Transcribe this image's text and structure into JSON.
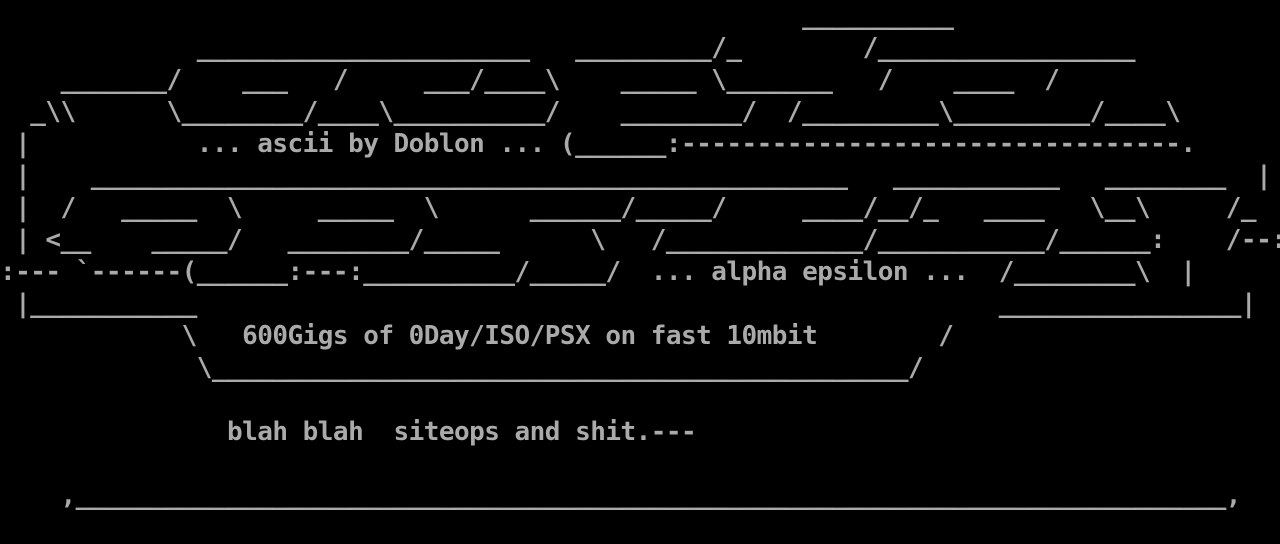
{
  "terminal": {
    "background_color": "#000000",
    "text_color": "#aaaaaa",
    "lines": [
      "                                                     __________",
      "             ______________________   _________/_        /_________________",
      "    _______/    ___   /     ___/____\\    _____ \\_______   /    ____  /",
      "  _\\\\      \\________/____\\__________/    ________/  /_________\\_________/____\\",
      " |           ... ascii by Doblon ... (______:---------------------------------.",
      " |    __________________________________________________   ___________   ________  |",
      " |  /   _____  \\     _____  \\      ______/_____/     ____/__/_   ____   \\__\\     /_  |",
      " | <__    _____/   ________/_____      \\   /_____________/___________/______:    /--:",
      ":--- `------(______:---:__________/_____/  ... alpha epsilon ...  /________\\  |",
      " |___________                                                     ________________|",
      "            \\   600Gigs of 0Day/ISO/PSX on fast 10mbit        /",
      "             \\______________________________________________/",
      "",
      "               blah blah  siteops and shit.---",
      "",
      "    ,____________________________________________________________________________,"
    ]
  }
}
